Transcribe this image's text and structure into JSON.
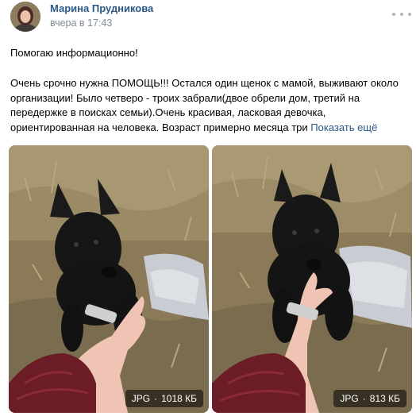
{
  "post": {
    "author_name": "Марина Прудникова",
    "timestamp": "вчера в 17:43",
    "text": {
      "line1": "Помогаю информационно!",
      "lines": [
        "Очень срочно нужна ПОМОЩЬ!!! Остался один щенок с мамой, выживают около",
        "организации! Было четверо - троих забрали(двое обрели дом, третий на",
        "передержке в поисках семьи).Очень красивая, ласковая девочка,",
        "ориентированная на человека. Возраст примерно месяца три "
      ],
      "show_more": "Показать ещё"
    },
    "attachments": [
      {
        "format": "JPG",
        "separator": "·",
        "size": "1018 КБ"
      },
      {
        "format": "JPG",
        "separator": "·",
        "size": "813 КБ"
      }
    ]
  },
  "colors": {
    "link": "#2a5885",
    "meta": "#818c99",
    "background": "#ffffff"
  },
  "icons": {
    "more": "more-horizontal-icon"
  }
}
